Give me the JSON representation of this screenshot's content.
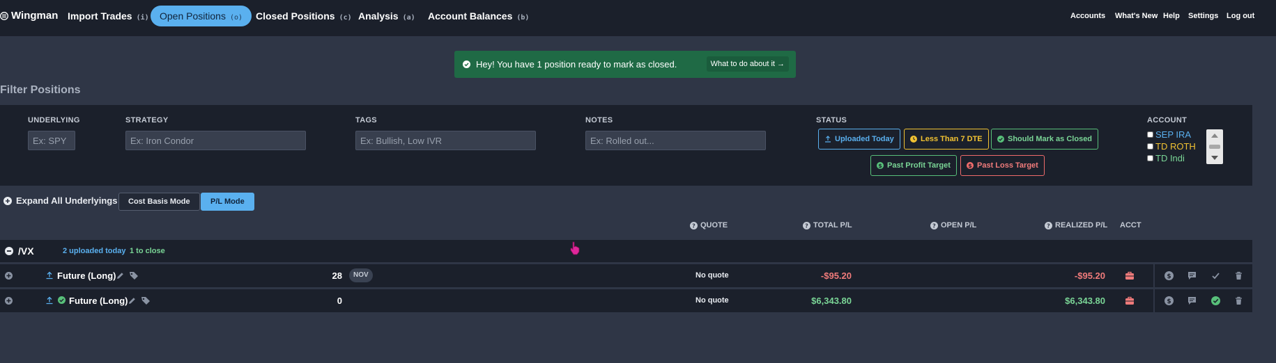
{
  "nav": {
    "brand": "Wingman",
    "items": [
      {
        "label": "Import Trades",
        "key": "(i)"
      },
      {
        "label": "Open Positions",
        "key": "(o)"
      },
      {
        "label": "Closed Positions",
        "key": "(c)"
      },
      {
        "label": "Analysis",
        "key": "(a)"
      },
      {
        "label": "Account Balances",
        "key": "(b)"
      }
    ],
    "right_links": [
      "Accounts",
      "What's New",
      "Help",
      "Settings",
      "Log out"
    ]
  },
  "alert": {
    "text": "Hey! You have 1 position ready to mark as closed.",
    "link": "What to do about it →"
  },
  "filter": {
    "title": "Filter Positions",
    "underlying": {
      "label": "UNDERLYING",
      "placeholder": "Ex: SPY"
    },
    "strategy": {
      "label": "STRATEGY",
      "placeholder": "Ex: Iron Condor"
    },
    "tags": {
      "label": "TAGS",
      "placeholder": "Ex: Bullish, Low IVR"
    },
    "notes": {
      "label": "NOTES",
      "placeholder": "Ex: Rolled out..."
    },
    "status": {
      "label": "STATUS",
      "buttons": [
        "Uploaded Today",
        "Less Than 7 DTE",
        "Should Mark as Closed",
        "Past Profit Target",
        "Past Loss Target"
      ]
    },
    "account": {
      "label": "ACCOUNT",
      "options": [
        {
          "name": "SEP IRA",
          "color": "#5ab0ef"
        },
        {
          "name": "TD ROTH",
          "color": "#f1c232"
        },
        {
          "name": "TD Indi",
          "color": "#7ad596"
        }
      ]
    }
  },
  "controls": {
    "expand_all": "Expand All Underlyings",
    "cost_basis": "Cost Basis Mode",
    "pl_mode": "P/L Mode"
  },
  "table": {
    "headers": {
      "quote": "QUOTE",
      "total_pl": "TOTAL P/L",
      "open_pl": "OPEN P/L",
      "realized_pl": "REALIZED P/L",
      "acct": "ACCT"
    },
    "group": {
      "symbol": "/VX",
      "uploaded": "2 uploaded today",
      "to_close": "1 to close"
    },
    "rows": [
      {
        "name": "Future (Long)",
        "qty": "28",
        "month": "NOV",
        "quote": "No quote",
        "total_pl": "-$95.20",
        "realized_pl": "-$95.20"
      },
      {
        "name": "Future (Long)",
        "qty": "0",
        "quote": "No quote",
        "total_pl": "$6,343.80",
        "realized_pl": "$6,343.80"
      }
    ]
  },
  "colors": {
    "accent": "#5ab0ef",
    "positive": "#7ad596",
    "negative": "#f07b7b",
    "alert_bg": "#1f6a45"
  }
}
